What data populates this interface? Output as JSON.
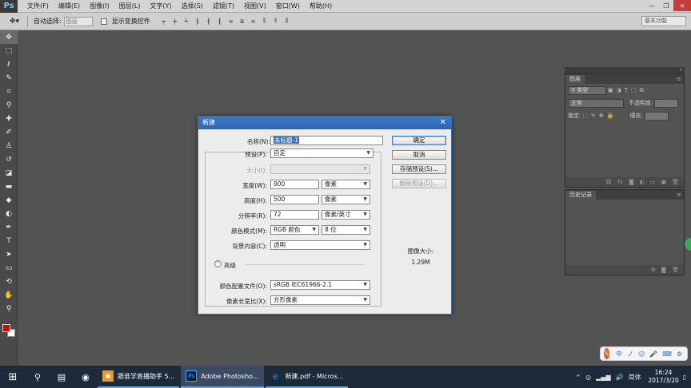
{
  "app": {
    "logo": "Ps"
  },
  "menu": [
    "文件(F)",
    "编辑(E)",
    "图像(I)",
    "图层(L)",
    "文字(Y)",
    "选择(S)",
    "滤镜(T)",
    "视图(V)",
    "窗口(W)",
    "帮助(H)"
  ],
  "window_controls": {
    "minimize": "—",
    "restore": "❐",
    "close": "✕"
  },
  "options_bar": {
    "auto_select_label": "自动选择:",
    "auto_select_value": "图层",
    "show_transform_label": "显示变换控件",
    "workspace": "基本功能"
  },
  "layers_panel": {
    "tab": "图层",
    "filter_kind": "类型",
    "blend_mode": "正常",
    "opacity_label": "不透明度:",
    "lock_label": "锁定:",
    "fill_label": "填充:"
  },
  "history_panel": {
    "tab": "历史记录"
  },
  "dialog": {
    "title": "新建",
    "close": "✕",
    "name_label": "名称(N):",
    "name_value": "未标题-1",
    "preset_label": "预设(P):",
    "preset_value": "自定",
    "size_label": "大小(I):",
    "width_label": "宽度(W):",
    "width_value": "900",
    "width_unit": "像素",
    "height_label": "高度(H):",
    "height_value": "500",
    "height_unit": "像素",
    "resolution_label": "分辨率(R):",
    "resolution_value": "72",
    "resolution_unit": "像素/英寸",
    "color_mode_label": "颜色模式(M):",
    "color_mode_value": "RGB 颜色",
    "bit_depth": "8 位",
    "background_label": "背景内容(C):",
    "background_value": "透明",
    "advanced_label": "高级",
    "profile_label": "颜色配置文件(O):",
    "profile_value": "sRGB IEC61966-2.1",
    "pixel_aspect_label": "像素长宽比(X):",
    "pixel_aspect_value": "方形像素",
    "ok": "确定",
    "cancel": "取消",
    "save_preset": "存储预设(S)...",
    "delete_preset": "删除预设(D)...",
    "image_size_label": "图像大小:",
    "image_size_value": "1.29M"
  },
  "ime": {
    "logo": "S",
    "mode": "中",
    "punct": "ノ",
    "extra": "⚙"
  },
  "taskbar": {
    "start": "⊞",
    "search": "⚲",
    "apps": [
      {
        "label": "跟谁学直播助手 5...",
        "glyph": "▣"
      },
      {
        "label": "Adobe Photosho...",
        "glyph": "Ps"
      },
      {
        "label": "新建.pdf - Micros...",
        "glyph": "e"
      }
    ],
    "ime_lang": "简体",
    "time": "16:24",
    "date": "2017/3/20"
  }
}
